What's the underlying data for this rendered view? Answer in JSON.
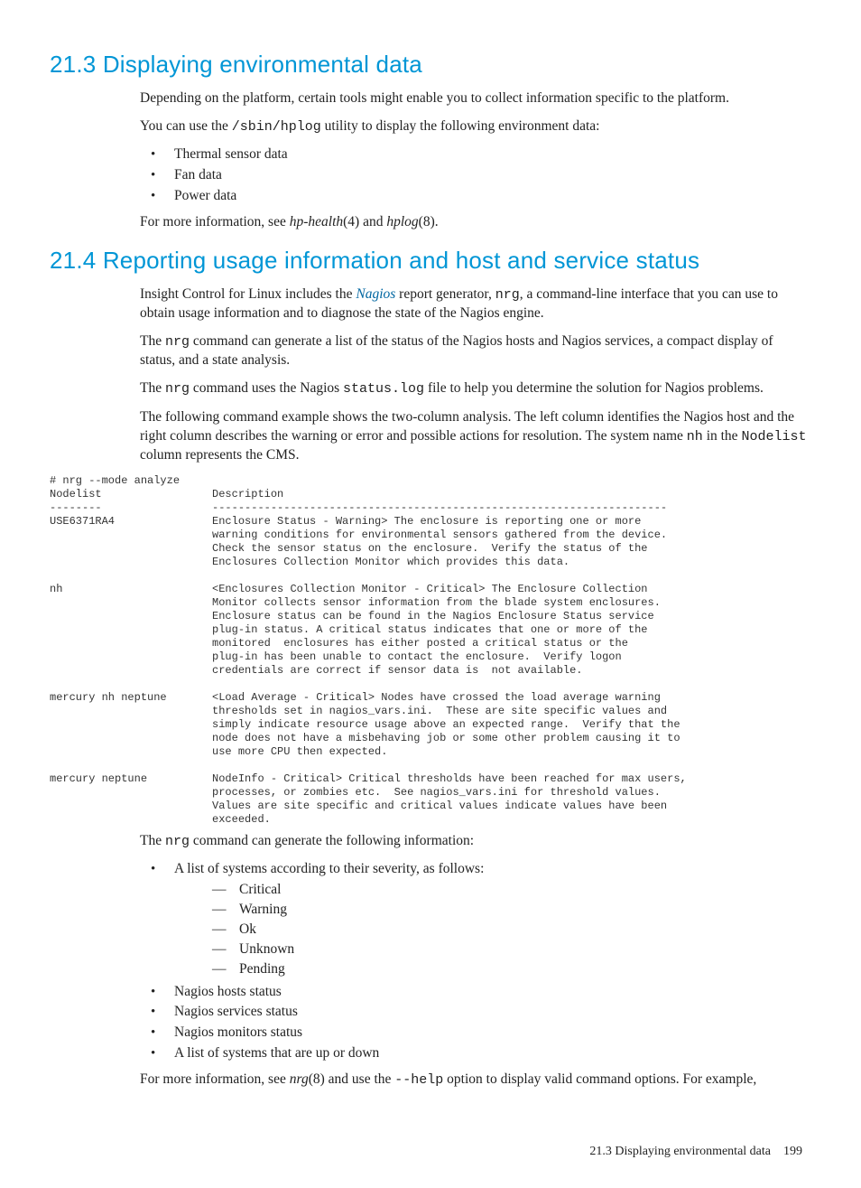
{
  "s1": {
    "heading": "21.3 Displaying environmental data",
    "p1": "Depending on the platform, certain tools might enable you to collect information specific to the platform.",
    "p2_a": "You can use the ",
    "p2_code": "/sbin/hplog",
    "p2_b": " utility to display the following environment data:",
    "bullets": {
      "b1": "Thermal sensor data",
      "b2": "Fan data",
      "b3": "Power data"
    },
    "p3_a": "For more information, see ",
    "p3_i1": "hp-health",
    "p3_mid": "(4) and ",
    "p3_i2": "hplog",
    "p3_b": "(8)."
  },
  "s2": {
    "heading": "21.4 Reporting usage information and host and service status",
    "p1_a": "Insight Control for Linux includes the ",
    "p1_link": "Nagios",
    "p1_b": " report generator, ",
    "p1_code": "nrg",
    "p1_c": ", a command-line interface that you can use to obtain usage information and to diagnose the state of the Nagios engine.",
    "p2_a": "The ",
    "p2_code": "nrg",
    "p2_b": " command can generate a list of the status of the Nagios hosts and Nagios services, a compact display of status, and a state analysis.",
    "p3_a": "The ",
    "p3_code1": "nrg",
    "p3_b": " command uses the Nagios ",
    "p3_code2": "status.log",
    "p3_c": " file to help you determine the solution for Nagios problems.",
    "p4_a": "The following command example shows the two-column analysis. The left column identifies the Nagios host and the right column describes the warning or error and possible actions for resolution. The system name ",
    "p4_code1": "nh",
    "p4_b": " in the ",
    "p4_code2": "Nodelist",
    "p4_c": " column represents the CMS.",
    "code": "# nrg --mode analyze\nNodelist                 Description\n--------                 ----------------------------------------------------------------------\nUSE6371RA4               Enclosure Status - Warning> The enclosure is reporting one or more\n                         warning conditions for environmental sensors gathered from the device.\n                         Check the sensor status on the enclosure.  Verify the status of the\n                         Enclosures Collection Monitor which provides this data.\n\nnh                       <Enclosures Collection Monitor - Critical> The Enclosure Collection\n                         Monitor collects sensor information from the blade system enclosures.\n                         Enclosure status can be found in the Nagios Enclosure Status service\n                         plug-in status. A critical status indicates that one or more of the\n                         monitored  enclosures has either posted a critical status or the\n                         plug-in has been unable to contact the enclosure.  Verify logon\n                         credentials are correct if sensor data is  not available.\n\nmercury nh neptune       <Load Average - Critical> Nodes have crossed the load average warning\n                         thresholds set in nagios_vars.ini.  These are site specific values and\n                         simply indicate resource usage above an expected range.  Verify that the\n                         node does not have a misbehaving job or some other problem causing it to\n                         use more CPU then expected.\n\nmercury neptune          NodeInfo - Critical> Critical thresholds have been reached for max users,\n                         processes, or zombies etc.  See nagios_vars.ini for threshold values.\n                         Values are site specific and critical values indicate values have been\n                         exceeded.",
    "p5_a": "The ",
    "p5_code": "nrg",
    "p5_b": " command can generate the following information:",
    "list": {
      "b1": "A list of systems according to their severity, as follows:",
      "s1": "Critical",
      "s2": "Warning",
      "s3": "Ok",
      "s4": "Unknown",
      "s5": "Pending",
      "b2": "Nagios hosts status",
      "b3": "Nagios services status",
      "b4": "Nagios monitors status",
      "b5": "A list of systems that are up or down"
    },
    "p6_a": "For more information, see ",
    "p6_i": "nrg",
    "p6_b": "(8) and use the ",
    "p6_code": "--help",
    "p6_c": " option to display valid command options. For example,"
  },
  "footer": {
    "text": "21.3 Displaying environmental data",
    "page": "199"
  }
}
